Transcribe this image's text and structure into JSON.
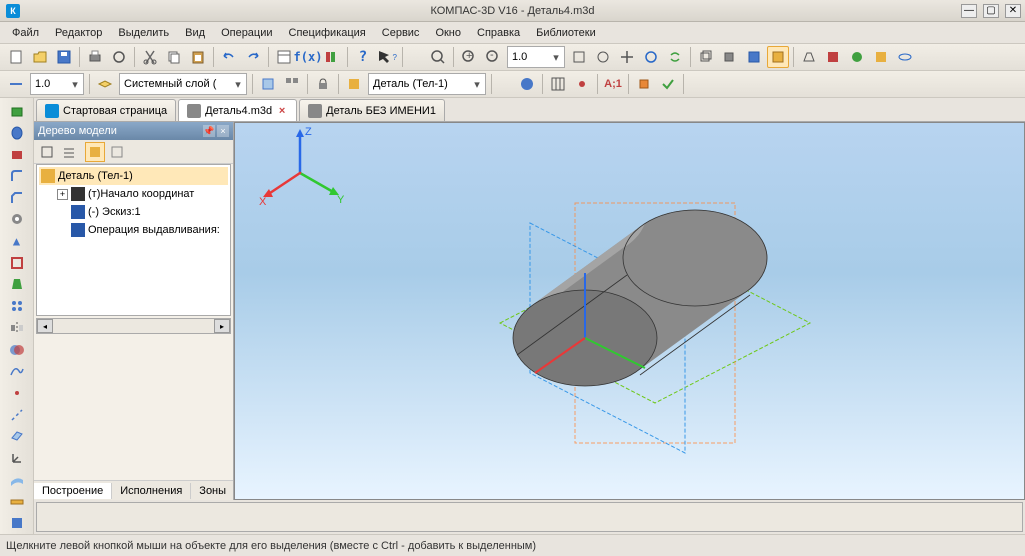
{
  "window": {
    "title": "КОМПАС-3D V16  -  Деталь4.m3d"
  },
  "menu": {
    "file": "Файл",
    "edit": "Редактор",
    "select": "Выделить",
    "view": "Вид",
    "ops": "Операции",
    "spec": "Спецификация",
    "service": "Сервис",
    "win": "Окно",
    "help": "Справка",
    "libs": "Библиотеки"
  },
  "toolbar2": {
    "scale1": "1.0",
    "layer": "Системный слой (",
    "part": "Деталь (Тел-1)",
    "zoom": "1.0"
  },
  "tabs": {
    "t0": "Стартовая страница",
    "t1": "Деталь4.m3d",
    "t2": "Деталь БЕЗ ИМЕНИ1"
  },
  "tree": {
    "title": "Дерево модели",
    "root": "Деталь (Тел-1)",
    "n1": "(т)Начало координат",
    "n2": "(-) Эскиз:1",
    "n3": "Операция выдавливания:",
    "tab_build": "Построение",
    "tab_exec": "Исполнения",
    "tab_zones": "Зоны"
  },
  "axis": {
    "x": "X",
    "y": "Y",
    "z": "Z"
  },
  "status": {
    "text": "Щелкните левой кнопкой мыши на объекте для его выделения (вместе с Ctrl - добавить к выделенным)"
  }
}
